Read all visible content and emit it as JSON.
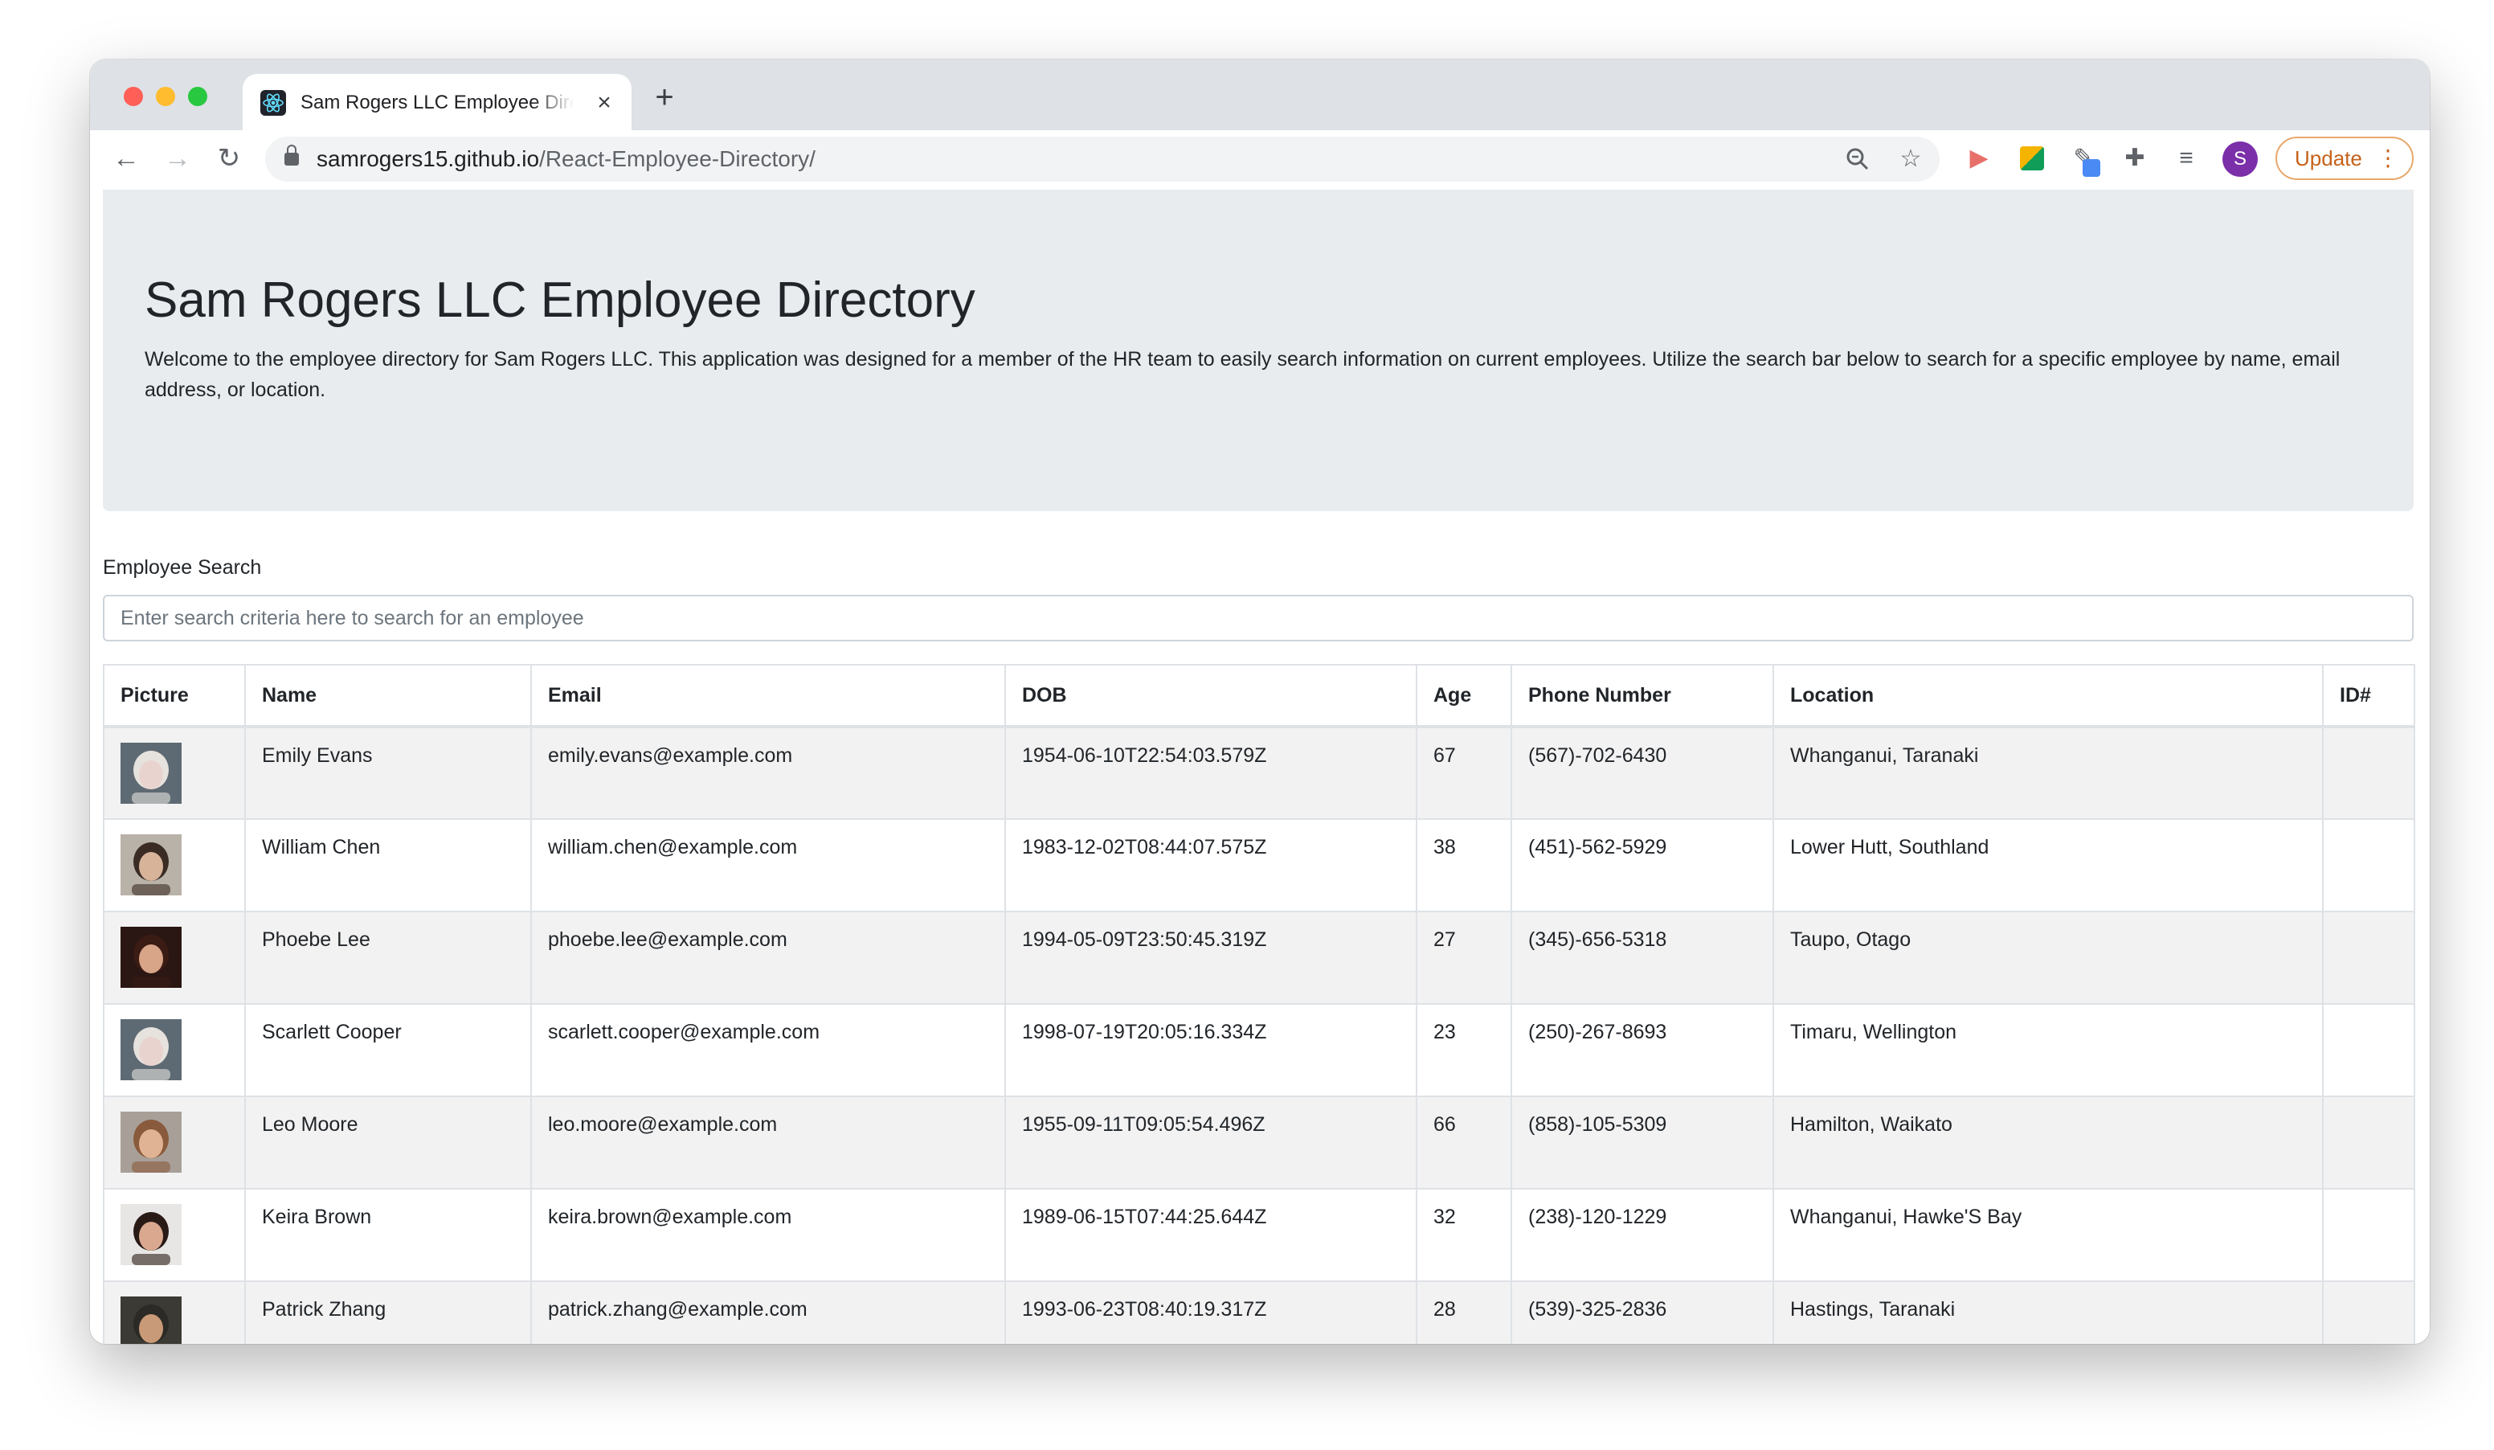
{
  "browser": {
    "tab_title": "Sam Rogers LLC Employee Directory",
    "url_host": "samrogers15.github.io",
    "url_path": "/React-Employee-Directory/",
    "avatar_initial": "S",
    "update_label": "Update"
  },
  "header": {
    "title": "Sam Rogers LLC Employee Directory",
    "description": "Welcome to the employee directory for Sam Rogers LLC. This application was designed for a member of the HR team to easily search information on current employees. Utilize the search bar below to search for a specific employee by name, email address, or location."
  },
  "search": {
    "label": "Employee Search",
    "placeholder": "Enter search criteria here to search for an employee",
    "value": ""
  },
  "table": {
    "columns": [
      "Picture",
      "Name",
      "Email",
      "DOB",
      "Age",
      "Phone Number",
      "Location",
      "ID#"
    ],
    "rows": [
      {
        "name": "Emily Evans",
        "email": "emily.evans@example.com",
        "dob": "1954-06-10T22:54:03.579Z",
        "age": "67",
        "phone": "(567)-702-6430",
        "location": "Whanganui, Taranaki",
        "id": "",
        "photo": {
          "bg": "#5e6a73",
          "skin": "#e9d3cf",
          "hair": "#e6e2de"
        }
      },
      {
        "name": "William Chen",
        "email": "william.chen@example.com",
        "dob": "1983-12-02T08:44:07.575Z",
        "age": "38",
        "phone": "(451)-562-5929",
        "location": "Lower Hutt, Southland",
        "id": "",
        "photo": {
          "bg": "#b8b2a8",
          "skin": "#d7b39a",
          "hair": "#3a2c24"
        }
      },
      {
        "name": "Phoebe Lee",
        "email": "phoebe.lee@example.com",
        "dob": "1994-05-09T23:50:45.319Z",
        "age": "27",
        "phone": "(345)-656-5318",
        "location": "Taupo, Otago",
        "id": "",
        "photo": {
          "bg": "#2a1612",
          "skin": "#d8a589",
          "hair": "#3b1c14"
        }
      },
      {
        "name": "Scarlett Cooper",
        "email": "scarlett.cooper@example.com",
        "dob": "1998-07-19T20:05:16.334Z",
        "age": "23",
        "phone": "(250)-267-8693",
        "location": "Timaru, Wellington",
        "id": "",
        "photo": {
          "bg": "#5e6a73",
          "skin": "#e9d3cf",
          "hair": "#e6e2de"
        }
      },
      {
        "name": "Leo Moore",
        "email": "leo.moore@example.com",
        "dob": "1955-09-11T09:05:54.496Z",
        "age": "66",
        "phone": "(858)-105-5309",
        "location": "Hamilton, Waikato",
        "id": "",
        "photo": {
          "bg": "#a8a098",
          "skin": "#e0b394",
          "hair": "#8a5a3c"
        }
      },
      {
        "name": "Keira Brown",
        "email": "keira.brown@example.com",
        "dob": "1989-06-15T07:44:25.644Z",
        "age": "32",
        "phone": "(238)-120-1229",
        "location": "Whanganui, Hawke'S Bay",
        "id": "",
        "photo": {
          "bg": "#e8e6e4",
          "skin": "#d9a88f",
          "hair": "#2a1a16"
        }
      },
      {
        "name": "Patrick Zhang",
        "email": "patrick.zhang@example.com",
        "dob": "1993-06-23T08:40:19.317Z",
        "age": "28",
        "phone": "(539)-325-2836",
        "location": "Hastings, Taranaki",
        "id": "",
        "photo": {
          "bg": "#3c3a34",
          "skin": "#c99a78",
          "hair": "#2c2a26"
        }
      }
    ]
  }
}
